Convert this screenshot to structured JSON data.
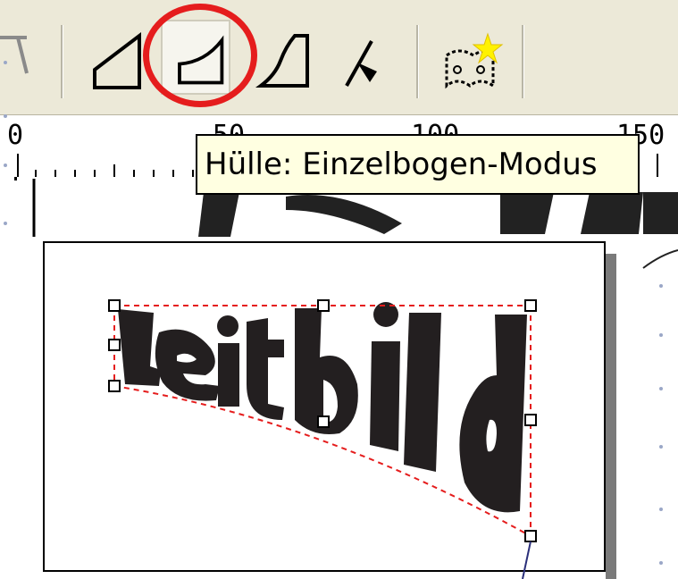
{
  "toolbar": {
    "buttons": [
      {
        "name": "envelope-straight-line-mode",
        "icon": "envelope-straight-line-icon"
      },
      {
        "name": "envelope-single-arc-mode",
        "icon": "envelope-single-arc-icon",
        "active": true
      },
      {
        "name": "envelope-double-arc-mode",
        "icon": "envelope-double-arc-icon"
      },
      {
        "name": "envelope-unconstrained-mode",
        "icon": "envelope-unconstrained-icon"
      },
      {
        "name": "add-new-envelope",
        "icon": "add-new-envelope-icon"
      }
    ]
  },
  "ruler": {
    "ticks": [
      "0",
      "50",
      "100",
      "150"
    ]
  },
  "tooltip": {
    "text": "Hülle: Einzelbogen-Modus"
  },
  "artwork": {
    "text": "leitbild"
  },
  "colors": {
    "highlight_circle": "#e51d1d",
    "envelope_dashes": "#e51d1d",
    "tooltip_bg": "#ffffe1",
    "toolbar_bg": "#ece9d8"
  }
}
